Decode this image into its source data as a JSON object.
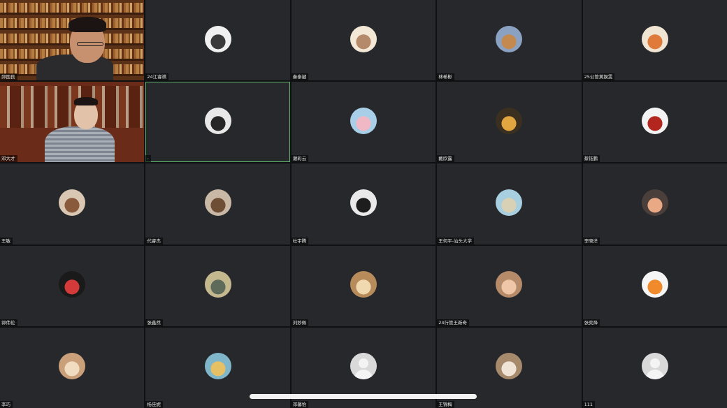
{
  "meeting": {
    "participants": [
      {
        "name": "邱国良",
        "type": "video1"
      },
      {
        "name": "24江睿祺",
        "type": "avatar",
        "color": "#f0f0f0",
        "accent": "#3a3a3a"
      },
      {
        "name": "秦泰键",
        "type": "avatar",
        "color": "#f3e8d6",
        "accent": "#b48a6a"
      },
      {
        "name": "林希彬",
        "type": "avatar",
        "color": "#8aa1c2",
        "accent": "#c4894f"
      },
      {
        "name": "25公管黄娱雯",
        "type": "avatar",
        "color": "#f0e4d2",
        "accent": "#e07a3a"
      },
      {
        "name": "邓大才",
        "type": "video2"
      },
      {
        "name": "-",
        "type": "avatar",
        "color": "#e8e8e8",
        "accent": "#262626",
        "active": true
      },
      {
        "name": "谢彩云",
        "type": "avatar",
        "color": "#a9cfe8",
        "accent": "#f0b7c4"
      },
      {
        "name": "戴欣露",
        "type": "avatar",
        "color": "#3b3020",
        "accent": "#e2a640"
      },
      {
        "name": "蔡钰鹏",
        "type": "avatar",
        "color": "#f3f3f3",
        "accent": "#b3261e"
      },
      {
        "name": "王敏",
        "type": "avatar",
        "color": "#d9c6b3",
        "accent": "#8a5a3c"
      },
      {
        "name": "代睿杰",
        "type": "avatar",
        "color": "#c9b8a6",
        "accent": "#6e4e35"
      },
      {
        "name": "杜宇腾",
        "type": "avatar",
        "color": "#e9e9e9",
        "accent": "#1d1d1d"
      },
      {
        "name": "王何平-汕头大学",
        "type": "avatar",
        "color": "#a8cfe0",
        "accent": "#d8d1b5"
      },
      {
        "name": "李晓洋",
        "type": "avatar",
        "color": "#4a3f3a",
        "accent": "#e8a984"
      },
      {
        "name": "郭伟伦",
        "type": "avatar",
        "color": "#1a1a1a",
        "accent": "#d53a3a"
      },
      {
        "name": "张鑫然",
        "type": "avatar",
        "color": "#c4b88f",
        "accent": "#5f6b5a"
      },
      {
        "name": "刘妙佩",
        "type": "avatar",
        "color": "#b88c5a",
        "accent": "#f0d9b0"
      },
      {
        "name": "24行管王新奇",
        "type": "avatar",
        "color": "#b58b6a",
        "accent": "#f0c6a8"
      },
      {
        "name": "张奕烽",
        "type": "avatar",
        "color": "#f5f5f5",
        "accent": "#f08a2a"
      },
      {
        "name": "李巧",
        "type": "avatar",
        "color": "#caa07a",
        "accent": "#f0dcc0"
      },
      {
        "name": "杨佳妮",
        "type": "avatar",
        "color": "#7fb6c9",
        "accent": "#e6c065"
      },
      {
        "name": "邓馨怡",
        "type": "default"
      },
      {
        "name": "王锦梅",
        "type": "avatar",
        "color": "#a78a6c",
        "accent": "#efe4d6"
      },
      {
        "name": "111",
        "type": "default"
      }
    ]
  }
}
